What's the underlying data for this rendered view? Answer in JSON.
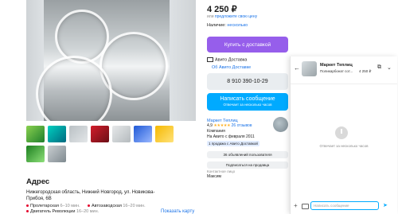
{
  "listing": {
    "price": "4 250 ₽",
    "price_suggest_prefix": "или",
    "price_suggest_link": "предложите свою цену",
    "stock_label": "Наличие:",
    "stock_value": "несколько",
    "buy_button": "Купить с доставкой",
    "delivery_label": "Авито Доставка",
    "about_delivery": "Об Авито Доставке",
    "phone": "8 910 390-10-29",
    "message_button": "Написать сообщение",
    "message_button_sub": "Отвечает за несколько часов"
  },
  "seller": {
    "name": "Маркет Теплиц",
    "stars": "★★★★★",
    "rating": "4,9",
    "reviews": "26 отзывов",
    "type": "Компания",
    "since": "На Авито с февраля 2011",
    "badge": "1 продажа с Авито Доставкой",
    "ads_button": "36 объявлений пользователя",
    "subscribe_button": "Подписаться на продавца",
    "contact_label": "Контактное лицо",
    "contact_name": "Максим"
  },
  "address": {
    "title": "Адрес",
    "line1": "Нижегородская область, Нижний Новгород, ул. Новикова-",
    "line2": "Прибоя, 6В",
    "metro": [
      {
        "name": "Пролетарская",
        "time": "6–10 мин.",
        "color": "#e4002b"
      },
      {
        "name": "Автозаводская",
        "time": "16–20 мин.",
        "color": "#e4002b"
      },
      {
        "name": "Двигатель Революции",
        "time": "16–20 мин.",
        "color": "#e4002b"
      }
    ],
    "show_map": "Показать карту"
  },
  "chat": {
    "title": "Маркет Теплиц",
    "subtitle": "Поликарбонат сот...",
    "price": "4 250 ₽",
    "empty_text": "Отвечает за несколько часов",
    "input_placeholder": "Написать сообщение"
  },
  "icons": [
    "truck-icon",
    "back-arrow-icon",
    "open-external-icon",
    "chevron-down-icon",
    "plus-icon",
    "camera-icon",
    "send-icon",
    "clock-icon"
  ],
  "colors": {
    "buy": "#965eeb",
    "message": "#00aaff",
    "link": "#1a73e8"
  }
}
